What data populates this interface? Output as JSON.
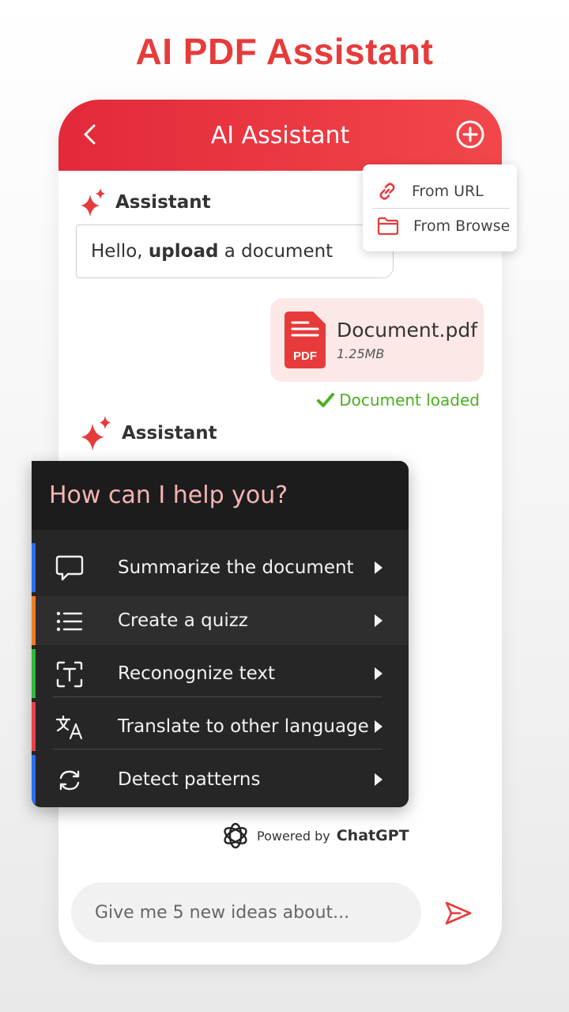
{
  "promo": {
    "title": "AI PDF Assistant"
  },
  "colors": {
    "brand_red": "#e73b3b",
    "appbar_start": "#e3293a",
    "appbar_end": "#f2474a",
    "success_green": "#4caf1e",
    "doc_bubble_bg": "#fde8e8",
    "help_title_pink": "#f7b3b5",
    "input_bg": "#f1f1f1",
    "accent_blue": "#2b6ef5",
    "accent_orange": "#f07e23",
    "accent_green": "#2fb83b",
    "accent_red": "#e9414a"
  },
  "appbar": {
    "title": "AI Assistant",
    "back_icon": "chevron-left-icon",
    "add_icon": "plus-circle-icon"
  },
  "source_menu": {
    "items": [
      {
        "label": "From URL",
        "icon": "link-icon"
      },
      {
        "label": "From Browse",
        "icon": "folder-icon"
      }
    ]
  },
  "chat": {
    "assistant_label_1": "Assistant",
    "greeting": {
      "before": "Hello, ",
      "bold": "upload",
      "after": " a document"
    },
    "document": {
      "name": "Document.pdf",
      "size": "1.25MB",
      "badge": "PDF"
    },
    "loaded_status": "Document loaded",
    "assistant_label_2": "Assistant"
  },
  "help_menu": {
    "title": "How can I help you?",
    "items": [
      {
        "label": "Summarize the document",
        "icon": "chat-bubble-icon",
        "accent": "#2b6ef5"
      },
      {
        "label": "Create a quizz",
        "icon": "list-icon",
        "accent": "#f07e23"
      },
      {
        "label": "Reconognize text",
        "icon": "text-scan-icon",
        "accent": "#2fb83b"
      },
      {
        "label": "Translate to other language",
        "icon": "translate-icon",
        "accent": "#e9414a"
      },
      {
        "label": "Detect patterns",
        "icon": "refresh-icon",
        "accent": "#2b6ef5"
      }
    ]
  },
  "powered": {
    "prefix": "Powered by",
    "brand": "ChatGPT"
  },
  "input": {
    "placeholder": "Give me 5 new ideas about...",
    "send_icon": "send-icon"
  }
}
